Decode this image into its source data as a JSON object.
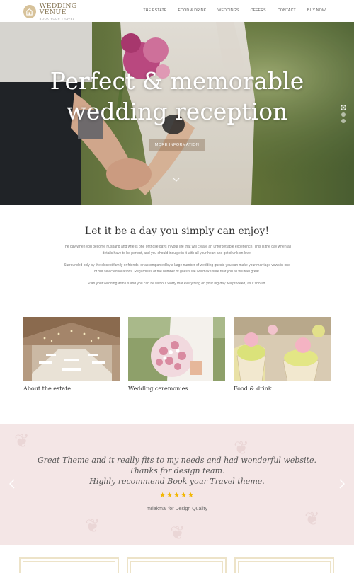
{
  "header": {
    "logo_title": "WEDDING VENUE",
    "logo_subtitle": "BOOK YOUR TRAVEL",
    "nav": [
      "THE ESTATE",
      "FOOD & DRINK",
      "WEDDINGS",
      "OFFERS",
      "CONTACT",
      "BUY NOW"
    ]
  },
  "hero": {
    "title_line1": "Perfect & memorable",
    "title_line2": "wedding reception",
    "button_label": "MORE INFORMATION",
    "slides_total": 3,
    "active_slide": 1
  },
  "intro": {
    "heading": "Let it be a day you simply can enjoy!",
    "paragraph1": "The day when you become husband and wife is one of those days in your life that will create an unforgettable experience. This is the day when all details have to be perfect, and you should indulge in it with all your heart and get drunk on love.",
    "paragraph2": "Surrounded only by the closest family or friends, or accompanied by a large number of wedding guests you can make your marriage vows in one of our selected locations. Regardless of the number of guests we will make sure that you all will feel great.",
    "paragraph3": "Plan your wedding with us and you can be without worry that everything on your big day will proceed, as it should."
  },
  "cards": [
    {
      "label": "About the estate"
    },
    {
      "label": "Wedding ceremonies"
    },
    {
      "label": "Food & drink"
    }
  ],
  "testimonial": {
    "line1": "Great Theme and it really fits to my needs and had wonderful website.",
    "line2": "Thanks for design team.",
    "line3": "Highly recommend Book your Travel theme.",
    "stars": "★★★★★",
    "rating": 5,
    "author": "mrlakmal for Design Quality"
  },
  "colors": {
    "accent_gold": "#d7c29a",
    "testimonial_bg": "#f4e6e6",
    "star": "#f2b705"
  }
}
